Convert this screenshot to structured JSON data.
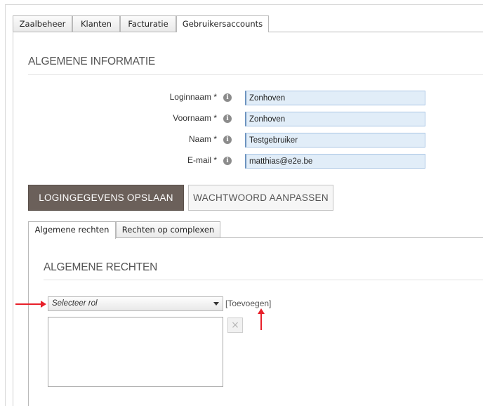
{
  "top_tabs": [
    {
      "label": "Zaalbeheer",
      "active": false
    },
    {
      "label": "Klanten",
      "active": false
    },
    {
      "label": "Facturatie",
      "active": false
    },
    {
      "label": "Gebruikersaccounts",
      "active": true
    }
  ],
  "general_info": {
    "title": "ALGEMENE INFORMATIE",
    "fields": [
      {
        "label": "Loginnaam *",
        "value": "Zonhoven"
      },
      {
        "label": "Voornaam *",
        "value": "Zonhoven"
      },
      {
        "label": "Naam *",
        "value": "Testgebruiker"
      },
      {
        "label": "E-mail *",
        "value": "matthias@e2e.be"
      }
    ],
    "info_icon_glyph": "i",
    "save_button": "LOGINGEGEVENS OPSLAAN",
    "password_button": "WACHTWOORD AANPASSEN"
  },
  "inner_tabs": [
    {
      "label": "Algemene rechten",
      "active": true
    },
    {
      "label": "Rechten op complexen",
      "active": false
    }
  ],
  "rights": {
    "title": "ALGEMENE RECHTEN",
    "role_select_value": "Selecteer rol",
    "add_link": "[Toevoegen]",
    "remove_glyph": "×"
  },
  "colors": {
    "primary_button": "#6b605a",
    "field_background": "#e1edf8",
    "annotation_arrow": "#e8202a"
  },
  "icons": {
    "info": "info-circle-icon",
    "remove": "close-icon",
    "dropdown": "chevron-down-icon"
  }
}
